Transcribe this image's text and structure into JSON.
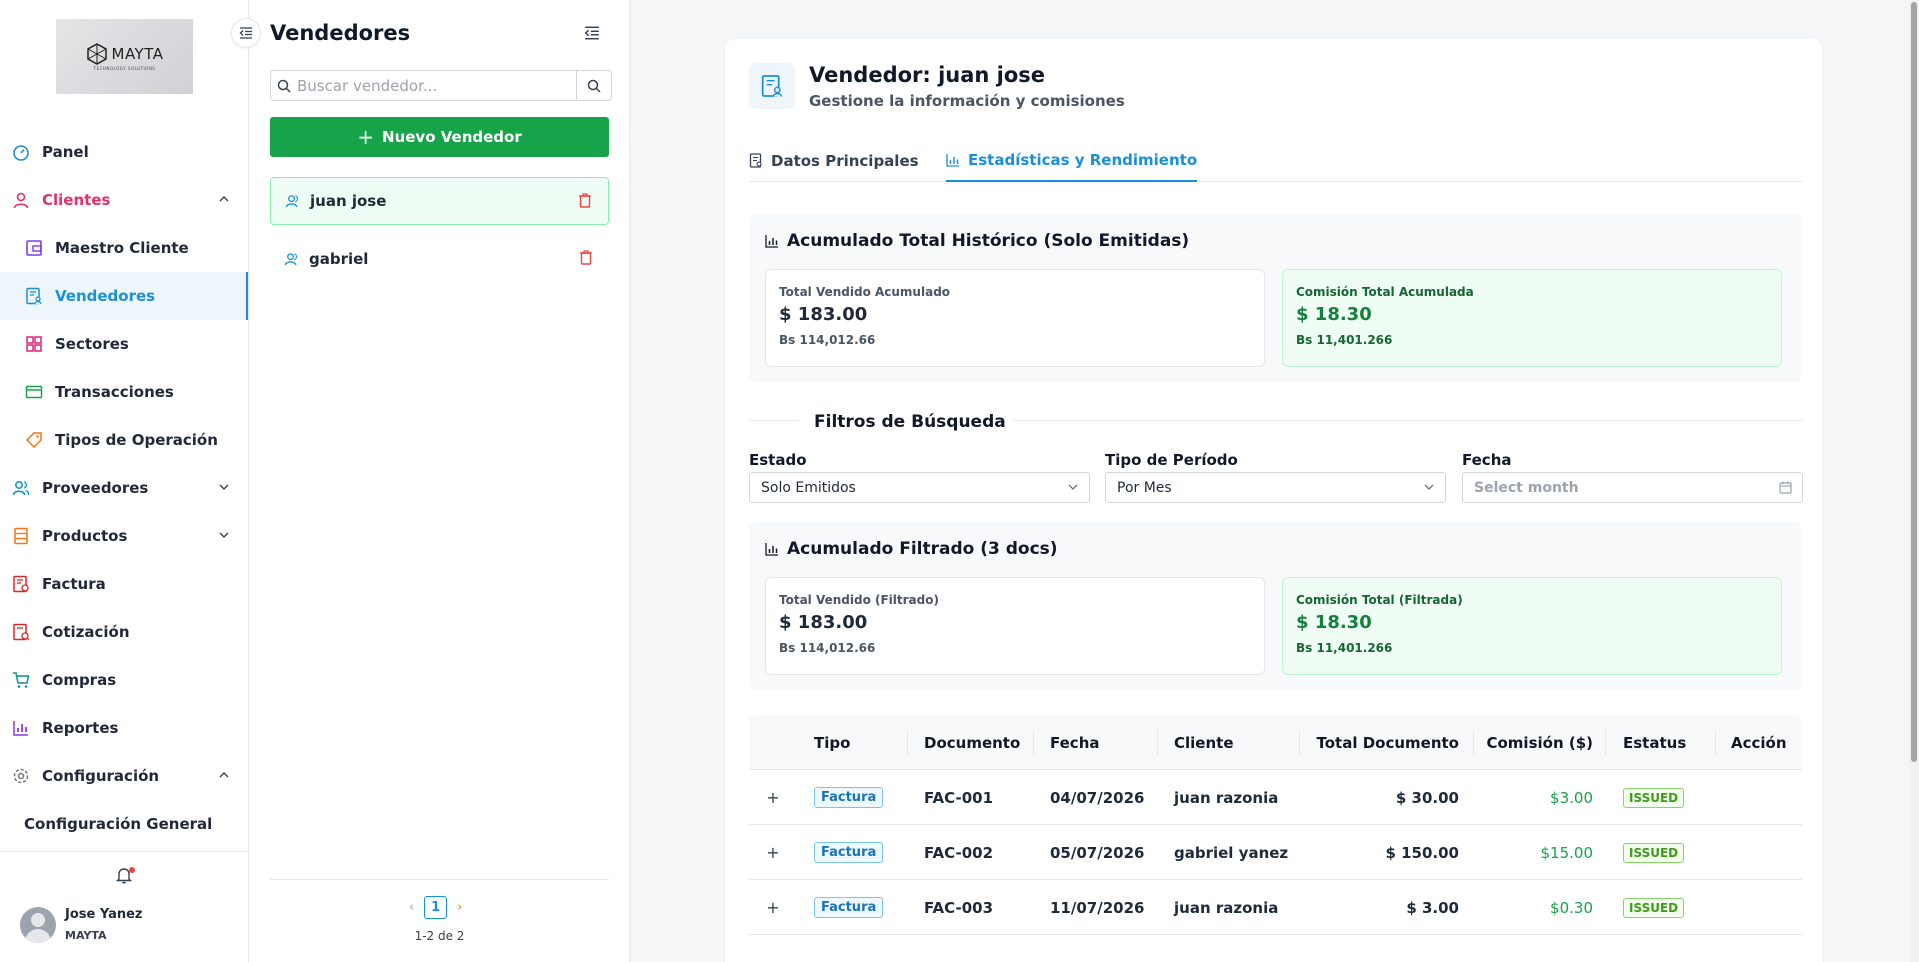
{
  "brand": {
    "logo_word": "MAYTA",
    "logo_sub": "TECHNOLOGY SOLUTIONS"
  },
  "sidebar": {
    "items": [
      {
        "label": "Panel",
        "icon": "dashboard-icon"
      },
      {
        "label": "Clientes",
        "icon": "user-icon"
      },
      {
        "label": "Maestro Cliente",
        "icon": "wallet-icon"
      },
      {
        "label": "Vendedores",
        "icon": "vendor-doc-icon"
      },
      {
        "label": "Sectores",
        "icon": "grid-icon"
      },
      {
        "label": "Transacciones",
        "icon": "card-icon"
      },
      {
        "label": "Tipos de Operación",
        "icon": "tag-icon"
      },
      {
        "label": "Proveedores",
        "icon": "team-icon"
      },
      {
        "label": "Productos",
        "icon": "database-icon"
      },
      {
        "label": "Factura",
        "icon": "invoice-icon"
      },
      {
        "label": "Cotización",
        "icon": "quote-icon"
      },
      {
        "label": "Compras",
        "icon": "cart-icon"
      },
      {
        "label": "Reportes",
        "icon": "bar-chart-icon"
      },
      {
        "label": "Configuración",
        "icon": "gear-icon"
      },
      {
        "label": "Configuración General",
        "icon": ""
      }
    ],
    "user": {
      "name": "Jose Yanez",
      "org": "MAYTA"
    }
  },
  "list_panel": {
    "title": "Vendedores",
    "search_placeholder": "Buscar vendedor...",
    "new_button": "Nuevo Vendedor",
    "vendors": [
      {
        "name": "juan jose"
      },
      {
        "name": "gabriel"
      }
    ],
    "current_page": "1",
    "range": "1-2 de 2"
  },
  "main": {
    "title": "Vendedor: juan jose",
    "subtitle": "Gestione la información y comisiones",
    "tabs": [
      {
        "label": "Datos Principales"
      },
      {
        "label": "Estadísticas y Rendimiento"
      }
    ],
    "historic": {
      "title": "Acumulado Total Histórico (Solo Emitidas)",
      "sold_label": "Total Vendido Acumulado",
      "sold_value": "$ 183.00",
      "sold_bs": "Bs 114,012.66",
      "comm_label": "Comisión Total Acumulada",
      "comm_value": "$ 18.30",
      "comm_bs": "Bs 11,401.266"
    },
    "filters": {
      "title": "Filtros de Búsqueda",
      "estado_label": "Estado",
      "estado_value": "Solo Emitidos",
      "periodo_label": "Tipo de Período",
      "periodo_value": "Por Mes",
      "fecha_label": "Fecha",
      "fecha_placeholder": "Select month"
    },
    "filtered": {
      "title": "Acumulado Filtrado (3 docs)",
      "sold_label": "Total Vendido (Filtrado)",
      "sold_value": "$ 183.00",
      "sold_bs": "Bs 114,012.66",
      "comm_label": "Comisión Total (Filtrada)",
      "comm_value": "$ 18.30",
      "comm_bs": "Bs 11,401.266"
    },
    "table": {
      "headers": {
        "tipo": "Tipo",
        "documento": "Documento",
        "fecha": "Fecha",
        "cliente": "Cliente",
        "total": "Total Documento",
        "comision": "Comisión ($)",
        "estatus": "Estatus",
        "accion": "Acción"
      },
      "rows": [
        {
          "tipo": "Factura",
          "documento": "FAC-001",
          "fecha": "04/07/2026",
          "cliente": "juan razonia",
          "total": "$ 30.00",
          "comision": "$3.00",
          "estatus": "ISSUED"
        },
        {
          "tipo": "Factura",
          "documento": "FAC-002",
          "fecha": "05/07/2026",
          "cliente": "gabriel yanez",
          "total": "$ 150.00",
          "comision": "$15.00",
          "estatus": "ISSUED"
        },
        {
          "tipo": "Factura",
          "documento": "FAC-003",
          "fecha": "11/07/2026",
          "cliente": "juan razonia",
          "total": "$ 3.00",
          "comision": "$0.30",
          "estatus": "ISSUED"
        }
      ]
    }
  },
  "colors": {
    "accent": "#1a8fdc",
    "primary_button": "#16a34a",
    "clientes_pink": "#e2306c"
  }
}
